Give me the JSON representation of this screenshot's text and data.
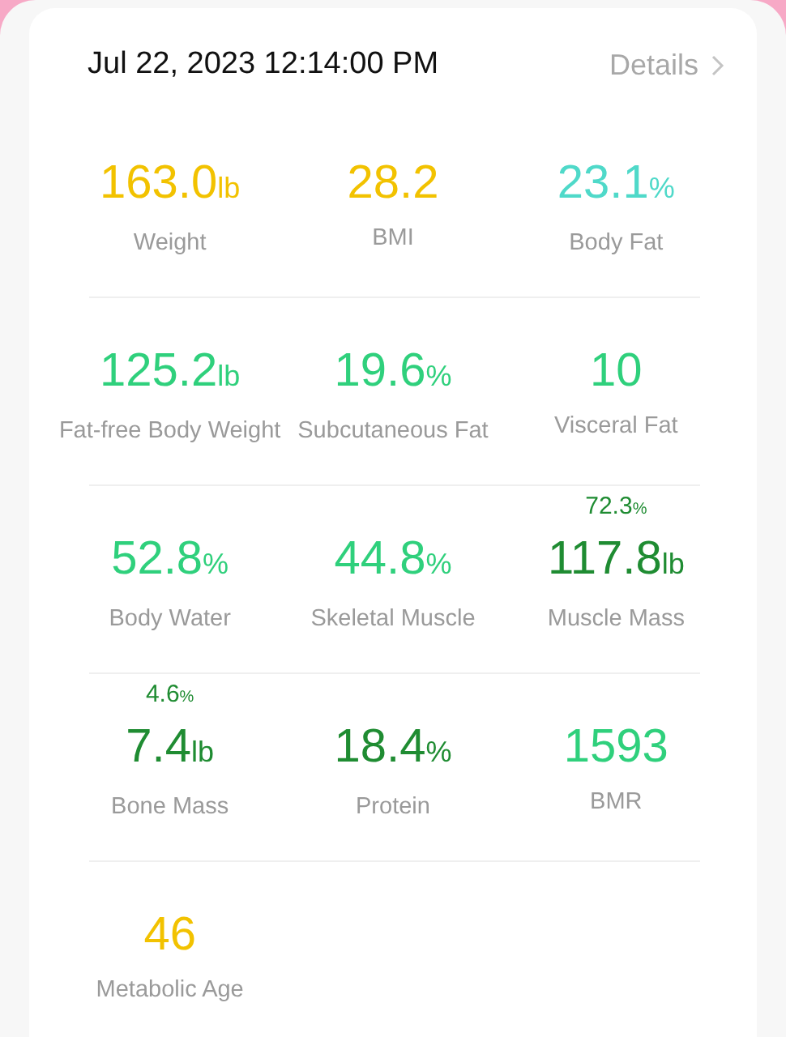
{
  "header": {
    "date": "Jul 22, 2023 12:14:00 PM",
    "details_link": "Details"
  },
  "metrics": [
    {
      "value": "163.0",
      "unit": "lb",
      "label": "Weight",
      "color": "#f2c200"
    },
    {
      "value": "28.2",
      "label": "BMI",
      "color": "#f2c200"
    },
    {
      "value": "23.1",
      "unit": "%",
      "label": "Body Fat",
      "color": "#4fd9c9"
    },
    {
      "value": "125.2",
      "unit": "lb",
      "label": "Fat-free Body Weight",
      "color": "#2fd07c"
    },
    {
      "value": "19.6",
      "unit": "%",
      "label": "Subcutaneous Fat",
      "color": "#2fd07c"
    },
    {
      "value": "10",
      "label": "Visceral Fat",
      "color": "#2fd07c"
    },
    {
      "value": "52.8",
      "unit": "%",
      "label": "Body Water",
      "color": "#2fd07c"
    },
    {
      "value": "44.8",
      "unit": "%",
      "label": "Skeletal Muscle",
      "color": "#2fd07c"
    },
    {
      "value": "117.8",
      "unit": "lb",
      "label": "Muscle Mass",
      "color": "#1f8c32",
      "sub_value": "72.3",
      "sub_unit": "%"
    },
    {
      "value": "7.4",
      "unit": "lb",
      "label": "Bone Mass",
      "color": "#1f8c32",
      "sub_value": "4.6",
      "sub_unit": "%"
    },
    {
      "value": "18.4",
      "unit": "%",
      "label": "Protein",
      "color": "#1f8c32"
    },
    {
      "value": "1593",
      "label": "BMR",
      "color": "#2fd07c"
    },
    {
      "value": "46",
      "label": "Metabolic Age",
      "color": "#f2c200"
    }
  ]
}
